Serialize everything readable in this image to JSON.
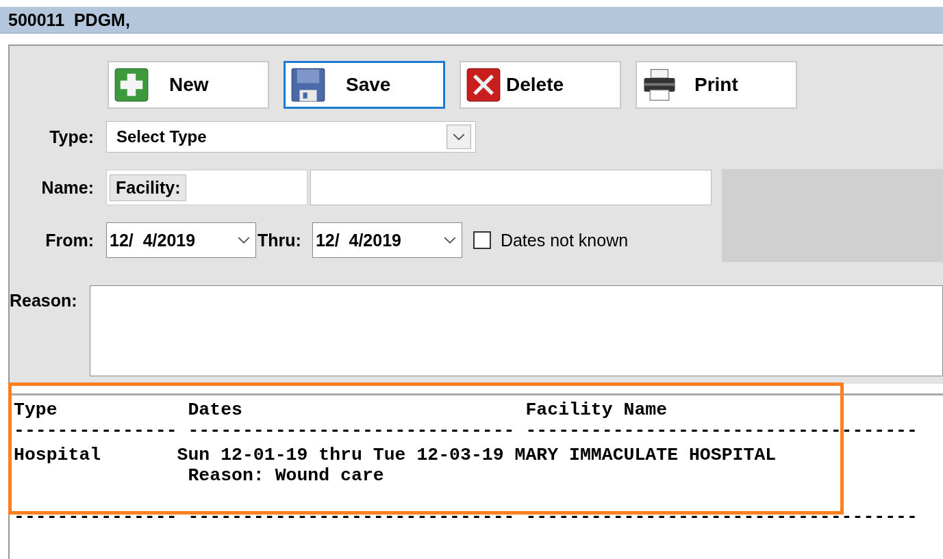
{
  "window": {
    "title": "500011  PDGM,"
  },
  "toolbar": [
    {
      "kind": "new",
      "label": "New",
      "selected": false
    },
    {
      "kind": "save",
      "label": "Save",
      "selected": true
    },
    {
      "kind": "delete",
      "label": "Delete",
      "selected": false
    },
    {
      "kind": "print",
      "label": "Print",
      "selected": false
    }
  ],
  "form": {
    "type_label": "Type:",
    "type_value": "Select Type",
    "name_label": "Name:",
    "name_prefix": "Facility:",
    "from_label": "From:",
    "from_value": "12/  4/2019",
    "thru_label": "Thru:",
    "thru_value": "12/  4/2019",
    "dates_not_known": {
      "label": "Dates not known",
      "checked": false
    },
    "reason_label": "Reason:"
  },
  "listing": {
    "lines": [
      "Type            Dates                          Facility Name",
      "--------------- ------------------------------ ------------------------------------",
      "Hospital       Sun 12-01-19 thru Tue 12-03-19 MARY IMMACULATE HOSPITAL",
      "                Reason: Wound care",
      "--------------- ------------------------------ ------------------------------------"
    ]
  }
}
